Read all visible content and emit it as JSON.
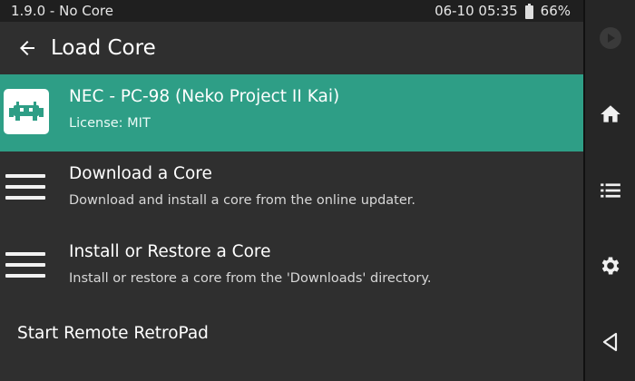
{
  "status": {
    "left_text": "1.9.0 - No Core",
    "datetime": "06-10 05:35",
    "battery": "66%"
  },
  "header": {
    "title": "Load Core",
    "back_icon": "arrow-left-icon"
  },
  "list": {
    "items": [
      {
        "title": "NEC - PC-98 (Neko Project II Kai)",
        "subtitle": "License: MIT",
        "icon": "retroarch-logo-icon",
        "selected": true
      },
      {
        "title": "Download a Core",
        "subtitle": "Download and install a core from the online updater.",
        "icon": "menu-icon"
      },
      {
        "title": "Install or Restore a Core",
        "subtitle": "Install or restore a core from the 'Downloads' directory.",
        "icon": "menu-icon"
      },
      {
        "title": "Start Remote RetroPad"
      }
    ]
  },
  "rail": {
    "buttons": [
      "play-icon",
      "home-icon",
      "list-icon",
      "gear-icon",
      "back-triangle-icon"
    ]
  },
  "colors": {
    "selected_row": "#2e9e86",
    "background": "#2f2f2f",
    "statusbar": "#1f1f1f",
    "rail": "#262626"
  }
}
